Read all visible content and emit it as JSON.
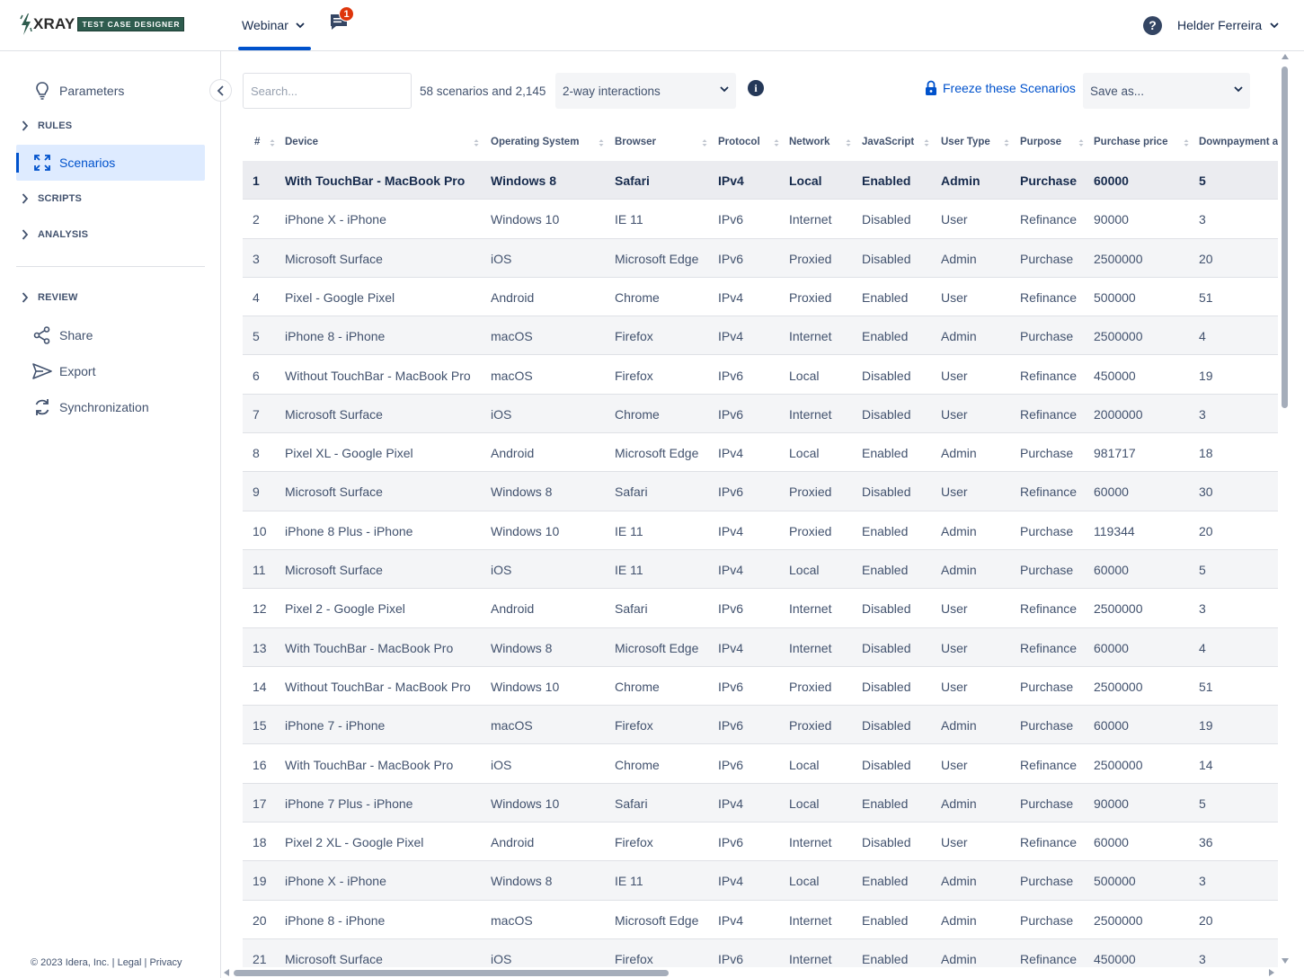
{
  "header": {
    "logo_text": "XRAY",
    "logo_badge": "TEST CASE DESIGNER",
    "project": "Webinar",
    "notifications_count": "1",
    "help_label": "?",
    "user_name": "Helder Ferreira"
  },
  "sidebar": {
    "parameters": "Parameters",
    "rules": "RULES",
    "scenarios": "Scenarios",
    "scripts": "SCRIPTS",
    "analysis": "ANALYSIS",
    "review": "REVIEW",
    "share": "Share",
    "export": "Export",
    "synchronization": "Synchronization",
    "footer": "© 2023 Idera, Inc. | Legal | Privacy"
  },
  "toolbar": {
    "search_placeholder": "Search...",
    "count_text": "58 scenarios and 2,145",
    "interaction": "2-way interactions",
    "info_label": "i",
    "freeze_label": "Freeze these Scenarios",
    "save_as": "Save as..."
  },
  "table": {
    "columns": [
      "#",
      "Device",
      "Operating System",
      "Browser",
      "Protocol",
      "Network",
      "JavaScript",
      "User Type",
      "Purpose",
      "Purchase price",
      "Downpayment a"
    ],
    "rows": [
      [
        "1",
        "With TouchBar - MacBook Pro",
        "Windows 8",
        "Safari",
        "IPv4",
        "Local",
        "Enabled",
        "Admin",
        "Purchase",
        "60000",
        "5"
      ],
      [
        "2",
        "iPhone X - iPhone",
        "Windows 10",
        "IE 11",
        "IPv6",
        "Internet",
        "Disabled",
        "User",
        "Refinance",
        "90000",
        "3"
      ],
      [
        "3",
        "Microsoft Surface",
        "iOS",
        "Microsoft Edge",
        "IPv6",
        "Proxied",
        "Disabled",
        "Admin",
        "Purchase",
        "2500000",
        "20"
      ],
      [
        "4",
        "Pixel - Google Pixel",
        "Android",
        "Chrome",
        "IPv4",
        "Proxied",
        "Enabled",
        "User",
        "Refinance",
        "500000",
        "51"
      ],
      [
        "5",
        "iPhone 8 - iPhone",
        "macOS",
        "Firefox",
        "IPv4",
        "Internet",
        "Enabled",
        "Admin",
        "Purchase",
        "2500000",
        "4"
      ],
      [
        "6",
        "Without TouchBar - MacBook Pro",
        "macOS",
        "Firefox",
        "IPv6",
        "Local",
        "Disabled",
        "User",
        "Refinance",
        "450000",
        "19"
      ],
      [
        "7",
        "Microsoft Surface",
        "iOS",
        "Chrome",
        "IPv6",
        "Internet",
        "Disabled",
        "User",
        "Refinance",
        "2000000",
        "3"
      ],
      [
        "8",
        "Pixel XL - Google Pixel",
        "Android",
        "Microsoft Edge",
        "IPv4",
        "Local",
        "Enabled",
        "Admin",
        "Purchase",
        "981717",
        "18"
      ],
      [
        "9",
        "Microsoft Surface",
        "Windows 8",
        "Safari",
        "IPv6",
        "Proxied",
        "Disabled",
        "User",
        "Refinance",
        "60000",
        "30"
      ],
      [
        "10",
        "iPhone 8 Plus - iPhone",
        "Windows 10",
        "IE 11",
        "IPv4",
        "Proxied",
        "Enabled",
        "Admin",
        "Purchase",
        "119344",
        "20"
      ],
      [
        "11",
        "Microsoft Surface",
        "iOS",
        "IE 11",
        "IPv4",
        "Local",
        "Enabled",
        "Admin",
        "Purchase",
        "60000",
        "5"
      ],
      [
        "12",
        "Pixel 2 - Google Pixel",
        "Android",
        "Safari",
        "IPv6",
        "Internet",
        "Disabled",
        "User",
        "Refinance",
        "2500000",
        "3"
      ],
      [
        "13",
        "With TouchBar - MacBook Pro",
        "Windows 8",
        "Microsoft Edge",
        "IPv4",
        "Internet",
        "Disabled",
        "User",
        "Refinance",
        "60000",
        "4"
      ],
      [
        "14",
        "Without TouchBar - MacBook Pro",
        "Windows 10",
        "Chrome",
        "IPv6",
        "Proxied",
        "Disabled",
        "User",
        "Purchase",
        "2500000",
        "51"
      ],
      [
        "15",
        "iPhone 7 - iPhone",
        "macOS",
        "Firefox",
        "IPv6",
        "Proxied",
        "Disabled",
        "Admin",
        "Purchase",
        "60000",
        "19"
      ],
      [
        "16",
        "With TouchBar - MacBook Pro",
        "iOS",
        "Chrome",
        "IPv6",
        "Local",
        "Disabled",
        "User",
        "Refinance",
        "2500000",
        "14"
      ],
      [
        "17",
        "iPhone 7 Plus - iPhone",
        "Windows 10",
        "Safari",
        "IPv4",
        "Local",
        "Enabled",
        "Admin",
        "Purchase",
        "90000",
        "5"
      ],
      [
        "18",
        "Pixel 2 XL - Google Pixel",
        "Android",
        "Firefox",
        "IPv6",
        "Internet",
        "Disabled",
        "User",
        "Refinance",
        "60000",
        "36"
      ],
      [
        "19",
        "iPhone X - iPhone",
        "Windows 8",
        "IE 11",
        "IPv4",
        "Local",
        "Enabled",
        "Admin",
        "Purchase",
        "500000",
        "3"
      ],
      [
        "20",
        "iPhone 8 - iPhone",
        "macOS",
        "Microsoft Edge",
        "IPv4",
        "Internet",
        "Enabled",
        "Admin",
        "Purchase",
        "2500000",
        "20"
      ],
      [
        "21",
        "Microsoft Surface",
        "iOS",
        "Firefox",
        "IPv6",
        "Internet",
        "Enabled",
        "Admin",
        "Refinance",
        "450000",
        "3"
      ]
    ]
  },
  "colors": {
    "accent": "#0052cc",
    "active_bg": "#deebff",
    "badge": "#de350b",
    "logo_green": "#2e5c4e"
  }
}
